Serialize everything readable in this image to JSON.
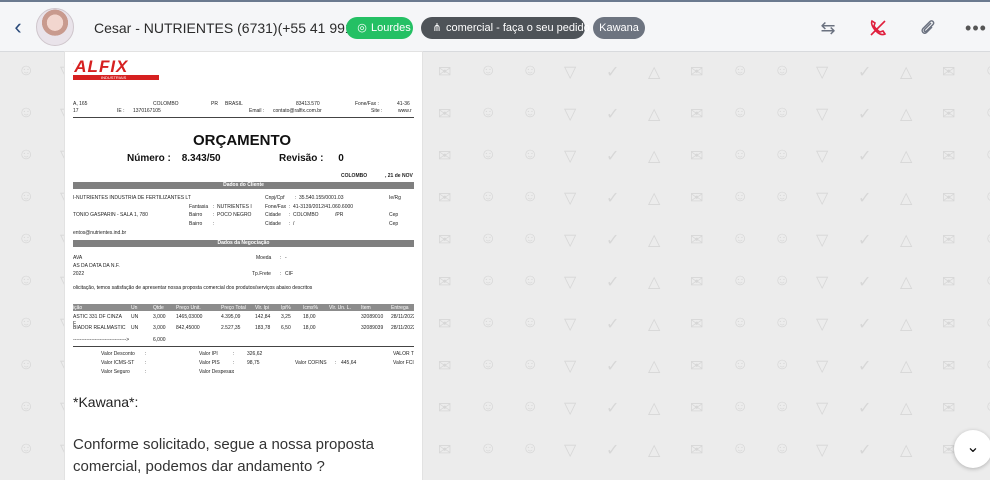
{
  "header": {
    "contact_name": "Cesar - NUTRIENTES (6731)",
    "contact_phone": "(+55 41 9912-8940)",
    "tags": [
      {
        "label": "Lourdes",
        "color": "#24c064"
      },
      {
        "label": "comercial - faça o seu pedido",
        "color": "#4e5358"
      },
      {
        "label": "Kawana",
        "color": "#6d7480"
      }
    ]
  },
  "icons": {
    "back": "chevron-left-icon",
    "whatsapp": "whatsapp-icon",
    "queue": "sitemap-icon",
    "transfer": "arrows-swap-icon",
    "end_call": "phone-off-icon",
    "attach": "paperclip-icon",
    "more": "more-icon",
    "scroll_down": "chevron-down-icon"
  },
  "document": {
    "logo": "RALFIX",
    "logo_sub": "INDUSTRIAIS",
    "addr_line1": [
      "A, 165",
      "COLOMBO",
      "PR",
      "BRASIL",
      "83413.570",
      "Fone/Fax :",
      "41-36"
    ],
    "addr_line2": [
      "17",
      "IE :",
      "1370167105",
      "Email :",
      "contato@ralfix.com.br",
      "Site :",
      "www.r"
    ],
    "title": "ORÇAMENTO",
    "number_label": "Número :",
    "number_value": "8.343/50",
    "revision_label": "Revisão :",
    "revision_value": "0",
    "place_date": [
      "COLOMBO",
      ", 21 de NOV"
    ],
    "client_band": "Dados do Cliente",
    "client_rows": [
      [
        "I-NUTRIENTES INDUSTRIA DE FERTILIZANTES LT",
        "Cnpj/Cpf",
        ":",
        "35.540.155/0001.03",
        "Ie/Rg"
      ],
      [
        "",
        "Fantasia",
        ":",
        "NUTRIENTES I",
        "Fone/Fax",
        ":",
        "41-3139/2012/41.060.6000"
      ],
      [
        "TONIO GASPARIN - SALA 1, 780",
        "Bairro",
        ":",
        "POCO NEGRO",
        "Cidade",
        ":",
        "COLOMBO",
        "/PR",
        "Cep"
      ],
      [
        "",
        "Bairro",
        ":",
        "",
        "Cidade",
        ":",
        "/",
        "",
        "Cep"
      ],
      [
        "entos@nutrientes.ind.br"
      ]
    ],
    "negotiation_band": "Dados da Negociação",
    "negotiation_rows": [
      [
        "AVA",
        "Moeda",
        ":",
        "-"
      ],
      [
        "AS DA DATA DA N.F."
      ],
      [
        "2022",
        "Tp.Frete",
        ":",
        "CIF"
      ]
    ],
    "intro": "olicitação, temos satisfação de apresentar nossa proposta comercial dos produtos/serviços abaixo descritos",
    "items_header": [
      "ição",
      "Un",
      "Qtde",
      "Preço Unit.",
      "Preço Total",
      "Vlr. Ipi",
      "Ipi%",
      "Icms%",
      "Vlr. Un. L.",
      "Item",
      "Entrega"
    ],
    "items": [
      [
        "ASTIC 331 DF CINZA",
        "UN",
        "3,000",
        "1465,03000",
        "4.395,09",
        "142,84",
        "3,25",
        "18,00",
        "",
        "32089010",
        "28/11/2022"
      ],
      [
        "F",
        "",
        "",
        "",
        "",
        "",
        "",
        "",
        "",
        "",
        ""
      ],
      [
        "BIADOR REALMASTIC",
        "UN",
        "3,000",
        "842,45000",
        "2.527,35",
        "183,78",
        "6,50",
        "18,00",
        "",
        "32089039",
        "28/11/2022"
      ],
      [
        "-------------------------------->",
        "",
        "6,000",
        "",
        "",
        "",
        "",
        "",
        "",
        "",
        ""
      ]
    ],
    "totals": [
      [
        "Valor Desconto",
        ":",
        "Valor IPI",
        ":",
        "326,62",
        "",
        "",
        "VALOR T"
      ],
      [
        "Valor ICMS-ST",
        ":",
        "Valor PIS",
        ":",
        "98,75",
        "Valor COFINS",
        ":",
        "445,64",
        "Valor FCI"
      ],
      [
        "Valor Seguro",
        ":",
        "Valor Despesas",
        ":"
      ]
    ]
  },
  "message": {
    "sender": "*Kawana*:",
    "body": "Conforme solicitado, segue a nossa proposta comercial, podemos dar andamento ?"
  }
}
